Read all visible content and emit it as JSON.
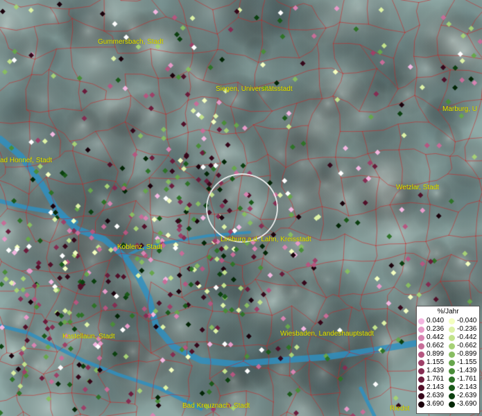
{
  "map": {
    "cities": [
      {
        "label": "Gummersbach, Stadt"
      },
      {
        "label": "Siegen, Universitätsstadt"
      },
      {
        "label": "Marburg, U"
      },
      {
        "label": "ad Honnef, Stadt"
      },
      {
        "label": "Wetzlar, Stadt"
      },
      {
        "label": "Limburg a.d. Lahn, Kreisstadt"
      },
      {
        "label": "Koblenz, Stadt"
      },
      {
        "label": "Kastellaun, Stadt"
      },
      {
        "label": "Wiesbaden, Landeshauptstadt"
      },
      {
        "label": "Bad Kreuznach, Stadt"
      },
      {
        "label": "Riedst"
      }
    ],
    "colors": {
      "border_lines": "#cc2222",
      "river": "#2f8fbf",
      "terrain_base": "#8fa9a6"
    }
  },
  "legend": {
    "title": "%/Jahr",
    "positive": [
      {
        "value": "0.040",
        "color": "#f3b6e0"
      },
      {
        "value": "0.236",
        "color": "#e79ac8"
      },
      {
        "value": "0.442",
        "color": "#d884b2"
      },
      {
        "value": "0.662",
        "color": "#c76d98"
      },
      {
        "value": "0.899",
        "color": "#b55680"
      },
      {
        "value": "1.155",
        "color": "#9e4068"
      },
      {
        "value": "1.439",
        "color": "#852d52"
      },
      {
        "value": "1.761",
        "color": "#6b1c3c"
      },
      {
        "value": "2.143",
        "color": "#511029"
      },
      {
        "value": "2.639",
        "color": "#36071a"
      },
      {
        "value": "3.690",
        "color": "#1a000b"
      }
    ],
    "negative": [
      {
        "value": "-0.040",
        "color": "#f4ffc0"
      },
      {
        "value": "-0.236",
        "color": "#ddf2a6"
      },
      {
        "value": "-0.442",
        "color": "#c3e38c"
      },
      {
        "value": "-0.662",
        "color": "#a6d176"
      },
      {
        "value": "-0.899",
        "color": "#88bd62"
      },
      {
        "value": "-1.155",
        "color": "#67a64c"
      },
      {
        "value": "-1.439",
        "color": "#4a8d39"
      },
      {
        "value": "-1.761",
        "color": "#2f7328"
      },
      {
        "value": "-2.143",
        "color": "#1b5a1a"
      },
      {
        "value": "-2.639",
        "color": "#0c4010"
      },
      {
        "value": "-3.690",
        "color": "#032606"
      }
    ]
  }
}
